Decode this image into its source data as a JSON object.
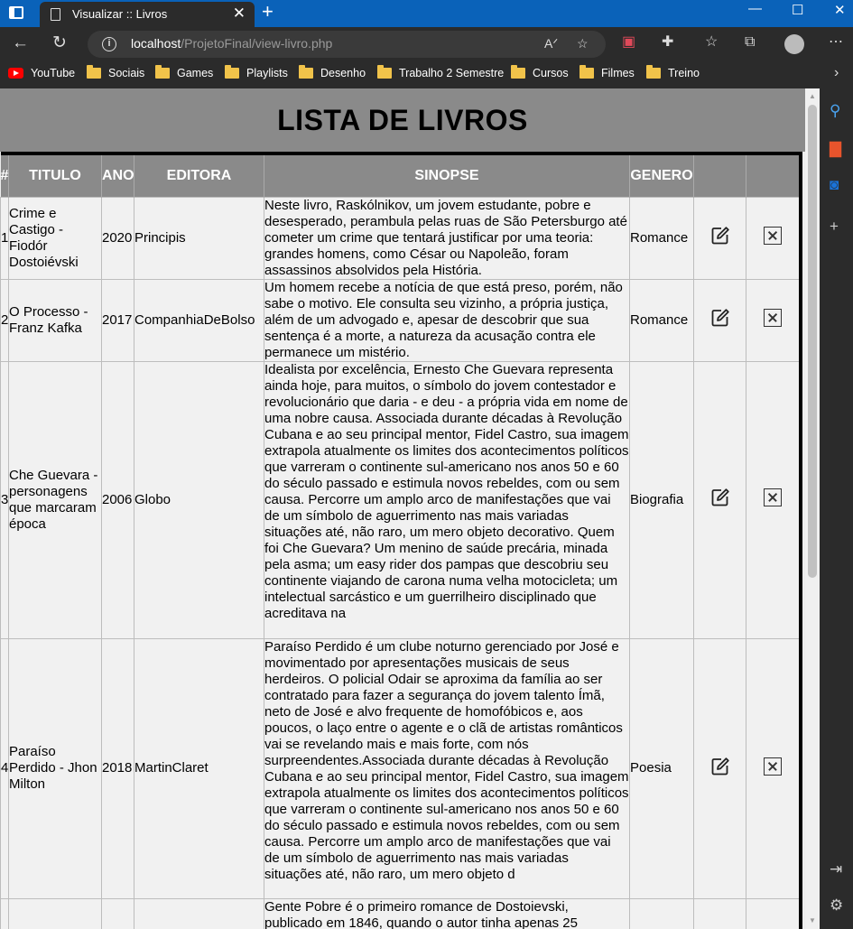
{
  "browser": {
    "tab_title": "Visualizar :: Livros",
    "url_host": "localhost",
    "url_path": "/ProjetoFinal/view-livro.php",
    "bookmarks": [
      "YouTube",
      "Sociais",
      "Games",
      "Playlists",
      "Desenho",
      "Trabalho 2 Semestre",
      "Cursos",
      "Filmes",
      "Treino"
    ]
  },
  "page": {
    "title": "LISTA DE LIVROS",
    "columns": [
      "#",
      "TITULO",
      "ANO",
      "EDITORA",
      "SINOPSE",
      "GENERO"
    ]
  },
  "books": [
    {
      "id": "1",
      "titulo": "Crime e Castigo - Fiodór Dostoiévski",
      "ano": "2020",
      "editora": "Principis",
      "sinopse": "Neste livro, Raskólnikov, um jovem estudante, pobre e desesperado, perambula pelas ruas de São Petersburgo até cometer um crime que tentará justificar por uma teoria: grandes homens, como César ou Napoleão, foram assassinos absolvidos pela História.",
      "genero": "Romance"
    },
    {
      "id": "2",
      "titulo": "O Processo - Franz Kafka",
      "ano": "2017",
      "editora": "CompanhiaDeBolso",
      "sinopse": "Um homem recebe a notícia de que está preso, porém, não sabe o motivo. Ele consulta seu vizinho, a própria justiça, além de um advogado e, apesar de descobrir que sua sentença é a morte, a natureza da acusação contra ele permanece um mistério.",
      "genero": "Romance"
    },
    {
      "id": "3",
      "titulo": "Che Guevara - personagens que marcaram época",
      "ano": "2006",
      "editora": "Globo",
      "sinopse": "Idealista por excelência, Ernesto Che Guevara representa ainda hoje, para muitos, o símbolo do jovem contestador e revolucionário que daria - e deu - a própria vida em nome de uma nobre causa. Associada durante décadas à Revolução Cubana e ao seu principal mentor, Fidel Castro, sua imagem extrapola atualmente os limites dos acontecimentos políticos que varreram o continente sul-americano nos anos 50 e 60 do século passado e estimula novos rebeldes, com ou sem causa. Percorre um amplo arco de manifestações que vai de um símbolo de aguerrimento nas mais variadas situações até, não raro, um mero objeto decorativo. Quem foi Che Guevara? Um menino de saúde precária, minada pela asma; um easy rider dos pampas que descobriu seu continente viajando de carona numa velha motocicleta; um intelectual sarcástico e um guerrilheiro disciplinado que acreditava na",
      "genero": "Biografia"
    },
    {
      "id": "4",
      "titulo": "Paraíso Perdido - Jhon Milton",
      "ano": "2018",
      "editora": "MartinClaret",
      "sinopse": "Paraíso Perdido é um clube noturno gerenciado por José e movimentado por apresentações musicais de seus herdeiros. O policial Odair se aproxima da família ao ser contratado para fazer a segurança do jovem talento Ímã, neto de José e alvo frequente de homofóbicos e, aos poucos, o laço entre o agente e o clã de artistas românticos vai se revelando mais e mais forte, com nós surpreendentes.Associada durante décadas à Revolução Cubana e ao seu principal mentor, Fidel Castro, sua imagem extrapola atualmente os limites dos acontecimentos políticos que varreram o continente sul-americano nos anos 50 e 60 do século passado e estimula novos rebeldes, com ou sem causa. Percorre um amplo arco de manifestações que vai de um símbolo de aguerrimento nas mais variadas situações até, não raro, um mero objeto d",
      "genero": "Poesia"
    },
    {
      "id": "",
      "titulo": "",
      "ano": "",
      "editora": "",
      "sinopse": "Gente Pobre é o primeiro romance de Dostoievski, publicado em 1846, quando o autor tinha apenas 25",
      "genero": ""
    }
  ]
}
